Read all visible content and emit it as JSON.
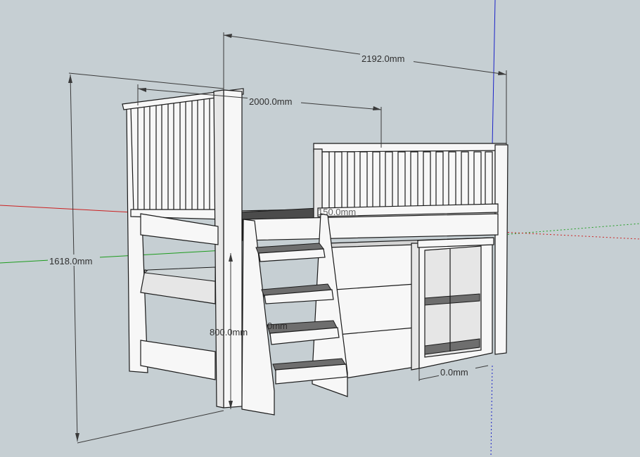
{
  "dimensions": {
    "overall_length": "2192.0mm",
    "bed_length": "2000.0mm",
    "overall_height": "1618.0mm",
    "platform_height": "800.0mm",
    "platform_gap": "0.0mm",
    "rail_label": "150.0mm",
    "ladder_partial": "0mm"
  },
  "axes": {
    "red": "#cc2020",
    "green": "#1d9c1d",
    "blue": "#1a22c8"
  },
  "colors": {
    "background": "#c6cfd3",
    "wood": "#f7f7f7",
    "tread": "#6e6e6e"
  }
}
